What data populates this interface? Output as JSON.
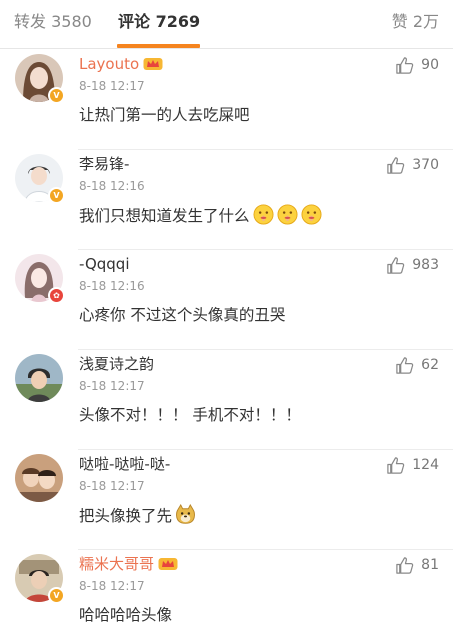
{
  "tabs": {
    "repost_label": "转发",
    "repost_count": "3580",
    "comment_label": "评论",
    "comment_count": "7269",
    "like_label": "赞",
    "like_count": "2万",
    "active_color": "#f5841f"
  },
  "comments": [
    {
      "username": "Layouto",
      "time": "8-18 12:17",
      "text": "让热门第一的人去吃屎吧",
      "likes": "90",
      "vip": true,
      "badge": "V",
      "emoji": []
    },
    {
      "username": "李易锋-",
      "time": "8-18 12:16",
      "text": "我们只想知道发生了什么",
      "likes": "370",
      "vip": false,
      "badge": "V",
      "emoji": [
        "shhh-emoji",
        "shhh-emoji",
        "shhh-emoji"
      ]
    },
    {
      "username": "-Qqqqi",
      "time": "8-18 12:16",
      "text": "心疼你 不过这个头像真的丑哭",
      "likes": "983",
      "vip": false,
      "badge": "V",
      "emoji": []
    },
    {
      "username": "浅夏诗之韵",
      "time": "8-18 12:17",
      "text": "头像不对！！！ 手机不对！！！",
      "likes": "62",
      "vip": false,
      "badge": "",
      "emoji": []
    },
    {
      "username": "哒啦-哒啦-哒-",
      "time": "8-18 12:17",
      "text": "把头像换了先",
      "likes": "124",
      "vip": false,
      "badge": "",
      "emoji": [
        "doge-emoji"
      ]
    },
    {
      "username": "糯米大哥哥",
      "time": "8-18 12:17",
      "text": "哈哈哈哈头像",
      "likes": "81",
      "vip": true,
      "badge": "V",
      "emoji": []
    }
  ],
  "colors": {
    "vip_name": "#eb7350",
    "verified_badge": "#f3a623",
    "red_badge": "#e8453c"
  }
}
